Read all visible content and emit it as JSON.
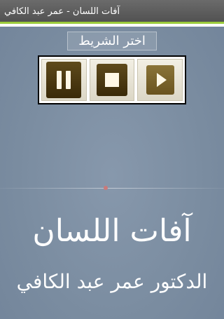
{
  "window": {
    "title": "آفات اللسان - عمر عبد الكافي"
  },
  "header": {
    "choose_label": "اختر الشريط"
  },
  "player": {
    "buttons": [
      {
        "icon": "pause-icon"
      },
      {
        "icon": "stop-icon"
      },
      {
        "icon": "play-icon"
      }
    ]
  },
  "content": {
    "title": "آفات اللسان",
    "author": "الدكتور عمر عبد الكافي"
  },
  "colors": {
    "accent": "#9ccc3c",
    "background": "#7d8fa3",
    "button_brown": "#4a3610"
  }
}
